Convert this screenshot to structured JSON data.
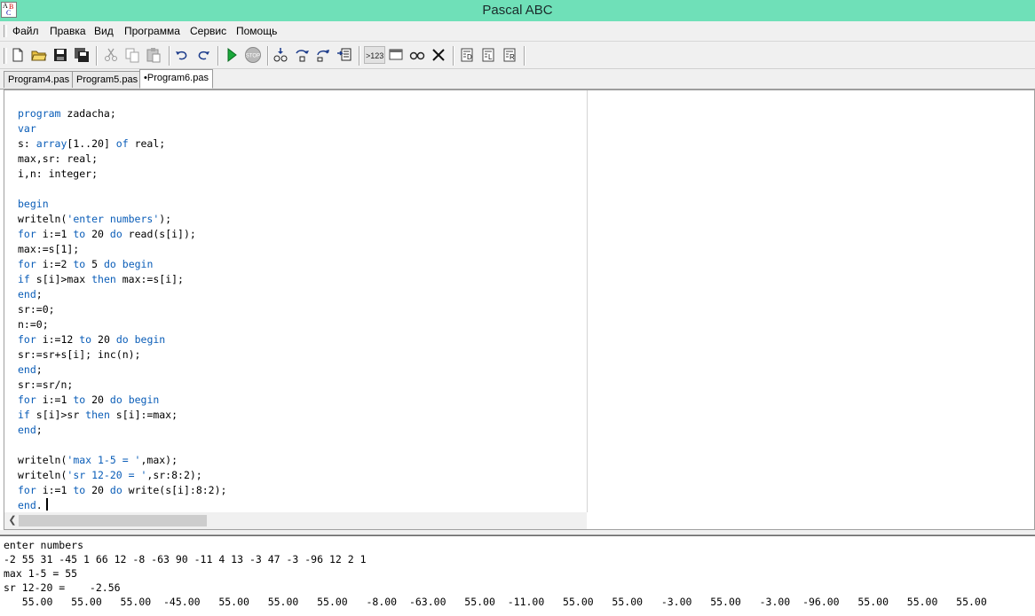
{
  "window": {
    "title": "Pascal ABC"
  },
  "menu": {
    "items": [
      "Файл",
      "Правка",
      "Вид",
      "Программа",
      "Сервис",
      "Помощь"
    ]
  },
  "toolbar": {
    "buttons": [
      {
        "icon": "new-file-icon"
      },
      {
        "icon": "open-folder-icon"
      },
      {
        "icon": "save-icon"
      },
      {
        "icon": "save-all-icon"
      },
      {
        "icon": "cut-icon"
      },
      {
        "icon": "copy-icon"
      },
      {
        "icon": "paste-icon"
      },
      {
        "icon": "undo-icon"
      },
      {
        "icon": "redo-icon"
      },
      {
        "icon": "run-icon"
      },
      {
        "icon": "stop-icon"
      },
      {
        "icon": "step-into-icon"
      },
      {
        "icon": "step-over-icon"
      },
      {
        "icon": "step-out-icon"
      },
      {
        "icon": "run-to-cursor-icon"
      },
      {
        "icon": "eval-expression-icon"
      },
      {
        "icon": "output-window-icon"
      },
      {
        "icon": "watch-icon"
      },
      {
        "icon": "close-icon"
      },
      {
        "icon": "format-d-icon"
      },
      {
        "icon": "format-l-icon"
      },
      {
        "icon": "format-r-icon"
      }
    ],
    "stop_label": "STOP",
    "eval_label": ">123"
  },
  "tabs": [
    {
      "label": "Program4.pas",
      "active": false
    },
    {
      "label": "Program5.pas",
      "active": false
    },
    {
      "label": "•Program6.pas",
      "active": true
    }
  ],
  "editor": {
    "lines": [
      [
        {
          "t": "program",
          "k": true
        },
        {
          "t": " zadacha;"
        }
      ],
      [
        {
          "t": "var",
          "k": true
        }
      ],
      [
        {
          "t": "s: "
        },
        {
          "t": "array",
          "k": true
        },
        {
          "t": "[1..20] "
        },
        {
          "t": "of",
          "k": true
        },
        {
          "t": " real;"
        }
      ],
      [
        {
          "t": "max,sr: real;"
        }
      ],
      [
        {
          "t": "i,n: integer;"
        }
      ],
      [],
      [
        {
          "t": "begin",
          "k": true
        }
      ],
      [
        {
          "t": "writeln("
        },
        {
          "t": "'enter numbers'",
          "s": true
        },
        {
          "t": ");"
        }
      ],
      [
        {
          "t": "for",
          "k": true
        },
        {
          "t": " i:=1 "
        },
        {
          "t": "to",
          "k": true
        },
        {
          "t": " 20 "
        },
        {
          "t": "do",
          "k": true
        },
        {
          "t": " read(s[i]);"
        }
      ],
      [
        {
          "t": "max:=s[1];"
        }
      ],
      [
        {
          "t": "for",
          "k": true
        },
        {
          "t": " i:=2 "
        },
        {
          "t": "to",
          "k": true
        },
        {
          "t": " 5 "
        },
        {
          "t": "do",
          "k": true
        },
        {
          "t": " "
        },
        {
          "t": "begin",
          "k": true
        }
      ],
      [
        {
          "t": "if",
          "k": true
        },
        {
          "t": " s[i]>max "
        },
        {
          "t": "then",
          "k": true
        },
        {
          "t": " max:=s[i];"
        }
      ],
      [
        {
          "t": "end",
          "k": true
        },
        {
          "t": ";"
        }
      ],
      [
        {
          "t": "sr:=0;"
        }
      ],
      [
        {
          "t": "n:=0;"
        }
      ],
      [
        {
          "t": "for",
          "k": true
        },
        {
          "t": " i:=12 "
        },
        {
          "t": "to",
          "k": true
        },
        {
          "t": " 20 "
        },
        {
          "t": "do",
          "k": true
        },
        {
          "t": " "
        },
        {
          "t": "begin",
          "k": true
        }
      ],
      [
        {
          "t": "sr:=sr+s[i]; inc(n);"
        }
      ],
      [
        {
          "t": "end",
          "k": true
        },
        {
          "t": ";"
        }
      ],
      [
        {
          "t": "sr:=sr/n;"
        }
      ],
      [
        {
          "t": "for",
          "k": true
        },
        {
          "t": " i:=1 "
        },
        {
          "t": "to",
          "k": true
        },
        {
          "t": " 20 "
        },
        {
          "t": "do",
          "k": true
        },
        {
          "t": " "
        },
        {
          "t": "begin",
          "k": true
        }
      ],
      [
        {
          "t": "if",
          "k": true
        },
        {
          "t": " s[i]>sr "
        },
        {
          "t": "then",
          "k": true
        },
        {
          "t": " s[i]:=max;"
        }
      ],
      [
        {
          "t": "end",
          "k": true
        },
        {
          "t": ";"
        }
      ],
      [],
      [
        {
          "t": "writeln("
        },
        {
          "t": "'max 1-5 = '",
          "s": true
        },
        {
          "t": ",max);"
        }
      ],
      [
        {
          "t": "writeln("
        },
        {
          "t": "'sr 12-20 = '",
          "s": true
        },
        {
          "t": ",sr:8:2);"
        }
      ],
      [
        {
          "t": "for",
          "k": true
        },
        {
          "t": " i:=1 "
        },
        {
          "t": "to",
          "k": true
        },
        {
          "t": " 20 "
        },
        {
          "t": "do",
          "k": true
        },
        {
          "t": " write(s[i]:8:2);"
        }
      ],
      [
        {
          "t": "end",
          "k": true
        },
        {
          "t": "."
        }
      ]
    ]
  },
  "output": {
    "lines": [
      "enter numbers",
      "-2 55 31 -45 1 66 12 -8 -63 90 -11 4 13 -3 47 -3 -96 12 2 1",
      "max 1-5 = 55",
      "sr 12-20 =    -2.56",
      "   55.00   55.00   55.00  -45.00   55.00   55.00   55.00   -8.00  -63.00   55.00  -11.00   55.00   55.00   -3.00   55.00   -3.00  -96.00   55.00   55.00   55.00"
    ]
  },
  "colors": {
    "titlebar": "#6fe0b8",
    "keyword": "#0a5db8",
    "chrome": "#f0f0f0"
  }
}
